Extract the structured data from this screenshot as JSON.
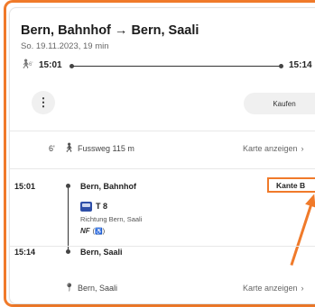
{
  "header": {
    "title": "Bern, Bahnhof → Bern, Saali",
    "subtitle": "So. 19.11.2023, 19 min"
  },
  "timeline": {
    "start_time": "15:01",
    "end_time": "15:14"
  },
  "actions": {
    "menu_icon_glyph": "⋮",
    "buy_label": "Kaufen"
  },
  "walk": {
    "minutes": "6'",
    "label": "Fussweg 115 m",
    "map_link": "Karte anzeigen",
    "chevron": "›"
  },
  "journey": {
    "origin_time": "15:01",
    "origin_name": "Bern, Bahnhof",
    "line": "T 8",
    "direction": "Richtung Bern, Saali",
    "nf_label": "NF",
    "nf_extra": "(♿)",
    "platform": "Kante B",
    "dest_time": "15:14",
    "dest_name": "Bern, Saali"
  },
  "destination": {
    "name": "Bern, Saali",
    "map_link": "Karte anzeigen",
    "chevron": "›"
  },
  "colors": {
    "accent": "#f07a2a",
    "tram_blue": "#2f4fa8"
  },
  "icons": {
    "walk": "walk-icon",
    "menu": "more-vertical-icon",
    "tram": "tram-icon",
    "pin": "location-pin-icon"
  }
}
